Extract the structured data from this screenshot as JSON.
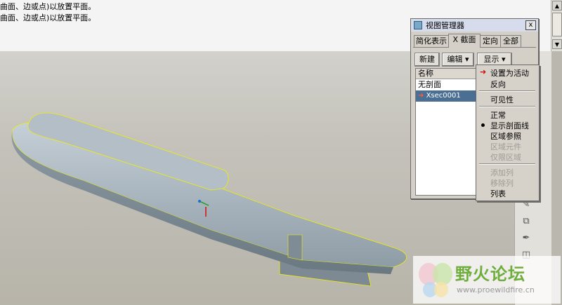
{
  "messages": [
    "曲面、边或点)以放置平面。",
    "曲面、边或点)以放置平面。"
  ],
  "dialog": {
    "title": "视图管理器",
    "close": "x",
    "tabs": [
      "简化表示",
      "X 截面",
      "定向",
      "全部"
    ],
    "buttons": {
      "new": "新建",
      "edit": "编辑 ▾",
      "display": "显示 ▾"
    },
    "list_header": "名称",
    "list_items": [
      "无剖面",
      "Xsec0001"
    ]
  },
  "menu": {
    "items": [
      "设置为活动",
      "反向",
      "可见性",
      "正常",
      "显示剖面线",
      "区域参照",
      "区域元件",
      "仅限区域",
      "添加列",
      "移除列",
      "列表"
    ]
  },
  "watermark": {
    "title": "野火论坛",
    "url": "www.proewildfire.cn"
  },
  "colors": {
    "model": "#9aa7b0",
    "edge_highlight": "#f0f000",
    "accent_red": "#d01010",
    "selection": "#4a6f93"
  }
}
